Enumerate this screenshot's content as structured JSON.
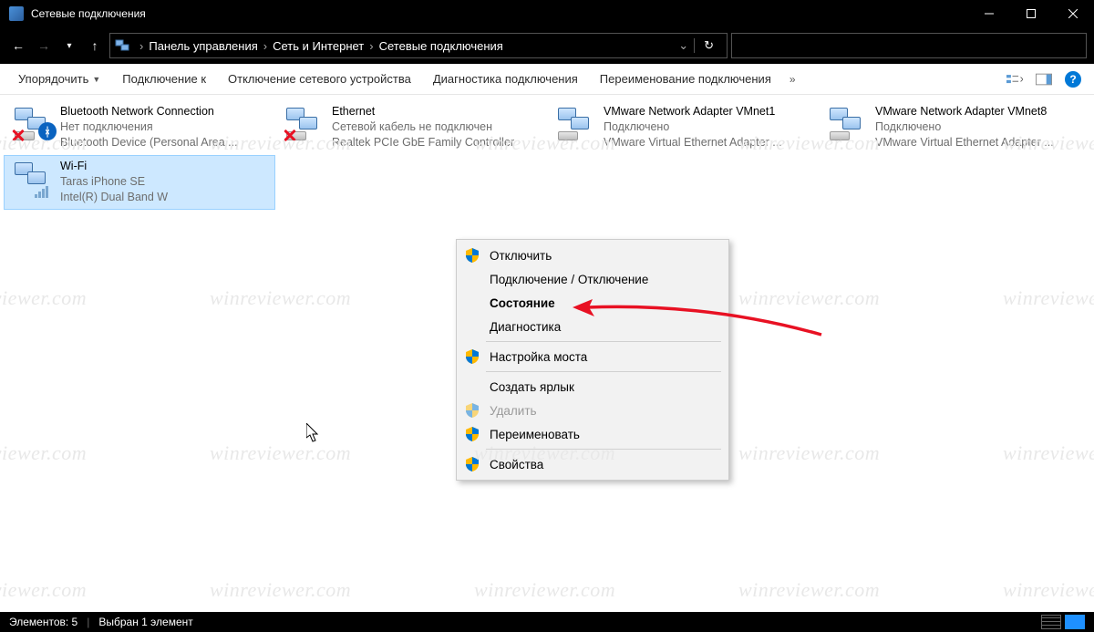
{
  "window": {
    "title": "Сетевые подключения"
  },
  "breadcrumbs": {
    "b0": "Панель управления",
    "b1": "Сеть и Интернет",
    "b2": "Сетевые подключения"
  },
  "toolbar": {
    "organize": "Упорядочить",
    "connect_to": "Подключение к",
    "disable_device": "Отключение сетевого устройства",
    "diagnose": "Диагностика подключения",
    "rename": "Переименование подключения",
    "help_glyph": "?"
  },
  "connections": [
    {
      "name": "Bluetooth Network Connection",
      "status": "Нет подключения",
      "device": "Bluetooth Device (Personal Area ...",
      "icon": "bt-disabled"
    },
    {
      "name": "Ethernet",
      "status": "Сетевой кабель не подключен",
      "device": "Realtek PCIe GbE Family Controller",
      "icon": "eth-disabled"
    },
    {
      "name": "VMware Network Adapter VMnet1",
      "status": "Подключено",
      "device": "VMware Virtual Ethernet Adapter ...",
      "icon": "eth"
    },
    {
      "name": "VMware Network Adapter VMnet8",
      "status": "Подключено",
      "device": "VMware Virtual Ethernet Adapter ...",
      "icon": "eth"
    },
    {
      "name": "Wi-Fi",
      "status": "Taras iPhone SE",
      "device": "Intel(R) Dual Band W",
      "icon": "wifi",
      "selected": true
    }
  ],
  "context_menu": {
    "disable": "Отключить",
    "connect_disconnect": "Подключение / Отключение",
    "status": "Состояние",
    "diagnose": "Диагностика",
    "bridge": "Настройка моста",
    "shortcut": "Создать ярлык",
    "delete": "Удалить",
    "rename": "Переименовать",
    "properties": "Свойства"
  },
  "statusbar": {
    "items": "Элементов: 5",
    "selected": "Выбран 1 элемент"
  },
  "watermark": "winreviewer.com"
}
